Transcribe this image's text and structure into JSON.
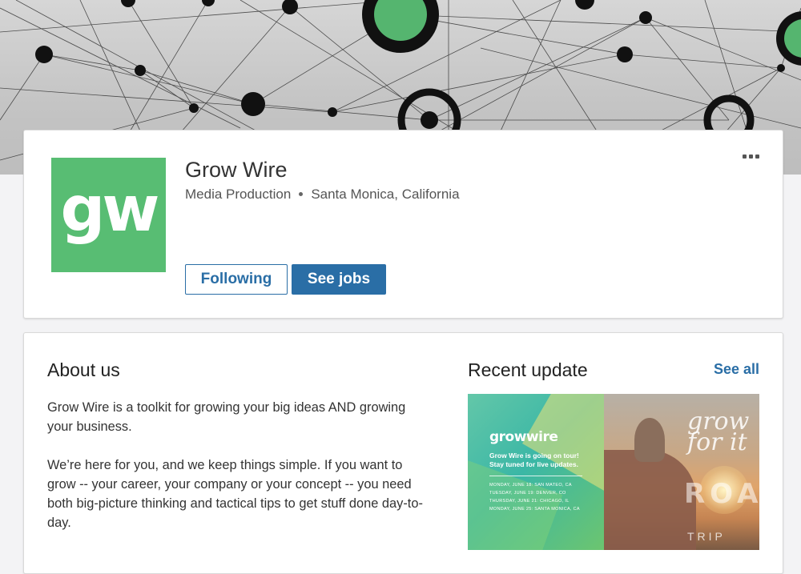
{
  "company": {
    "logo_text": "gw",
    "name": "Grow Wire",
    "industry": "Media Production",
    "location": "Santa Monica, California"
  },
  "actions": {
    "following_label": "Following",
    "see_jobs_label": "See jobs",
    "more_icon": "more-horizontal-icon"
  },
  "about": {
    "title": "About us",
    "paragraphs": [
      "Grow Wire is a toolkit for growing your big ideas AND growing your business.",
      "We’re here for you, and we keep things simple. If you want to grow -- your career, your company or your concept -- you need both big-picture thinking and tactical tips to get stuff done day-to-day."
    ]
  },
  "recent_update": {
    "title": "Recent update",
    "see_all_label": "See all",
    "image": {
      "brand": "growwire",
      "tour_text": "Grow Wire is going on tour! Stay tuned for live updates.",
      "dates": [
        "MONDAY, JUNE 18: SAN MATEO, CA",
        "TUESDAY, JUNE 19: DENVER, CO",
        "THURSDAY, JUNE 21: CHICAGO, IL",
        "MONDAY, JUNE 25: SANTA MONICA, CA"
      ],
      "overlay_script": "grow for it",
      "overlay_road": "ROAD",
      "overlay_trip": "TRIP"
    }
  },
  "colors": {
    "brand_green": "#58bd73",
    "link_blue": "#2a6ea6",
    "background": "#f3f3f5"
  }
}
